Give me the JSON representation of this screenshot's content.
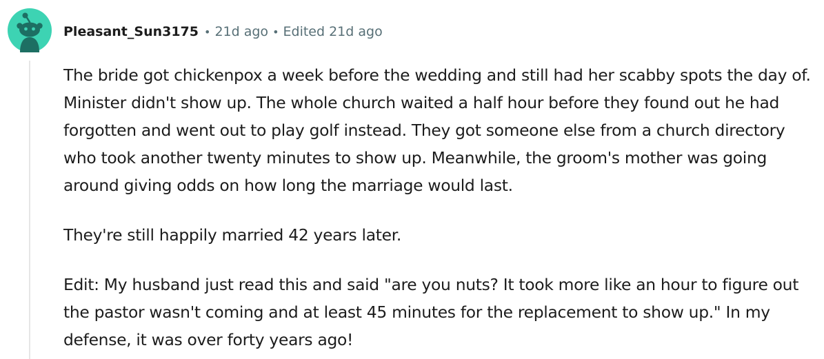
{
  "comment": {
    "author": "Pleasant_Sun3175",
    "separator": "•",
    "time_ago": "21d ago",
    "edited": "Edited 21d ago",
    "paragraphs": [
      "The bride got chickenpox a week before the wedding and still had her scabby spots the day of. Minister didn't show up. The whole church waited a half hour before they found out he had forgotten and went out to play golf instead. They got someone else from a church directory who took another twenty minutes to show up. Meanwhile, the groom's mother was going around giving odds on how long the marriage would last.",
      "They're still happily married 42 years later.",
      "Edit: My husband just read this and said \"are you nuts? It took more like an hour to figure out the pastor wasn't coming and at least 45 minutes for the replacement to show up.\" In my defense, it was over forty years ago!"
    ]
  },
  "colors": {
    "avatar_bg": "#3dd3b3",
    "avatar_figure": "#1d6f63",
    "meta_text": "#576f76",
    "body_text": "#1c1c1c",
    "thread_line": "#e6e6e6"
  },
  "icons": {
    "avatar": "reddit-snoo-avatar-icon"
  }
}
